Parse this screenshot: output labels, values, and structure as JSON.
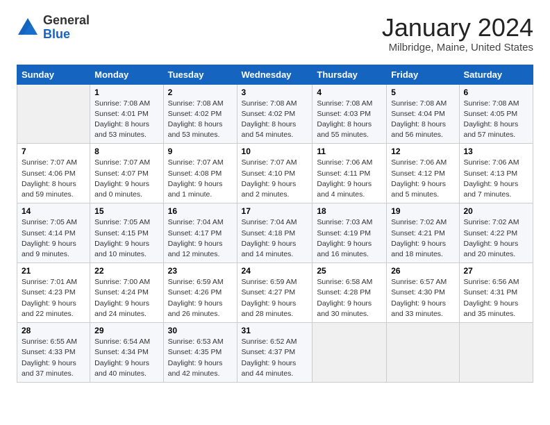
{
  "header": {
    "logo_general": "General",
    "logo_blue": "Blue",
    "title": "January 2024",
    "subtitle": "Milbridge, Maine, United States"
  },
  "days_of_week": [
    "Sunday",
    "Monday",
    "Tuesday",
    "Wednesday",
    "Thursday",
    "Friday",
    "Saturday"
  ],
  "weeks": [
    [
      {
        "num": "",
        "info": ""
      },
      {
        "num": "1",
        "info": "Sunrise: 7:08 AM\nSunset: 4:01 PM\nDaylight: 8 hours\nand 53 minutes."
      },
      {
        "num": "2",
        "info": "Sunrise: 7:08 AM\nSunset: 4:02 PM\nDaylight: 8 hours\nand 53 minutes."
      },
      {
        "num": "3",
        "info": "Sunrise: 7:08 AM\nSunset: 4:02 PM\nDaylight: 8 hours\nand 54 minutes."
      },
      {
        "num": "4",
        "info": "Sunrise: 7:08 AM\nSunset: 4:03 PM\nDaylight: 8 hours\nand 55 minutes."
      },
      {
        "num": "5",
        "info": "Sunrise: 7:08 AM\nSunset: 4:04 PM\nDaylight: 8 hours\nand 56 minutes."
      },
      {
        "num": "6",
        "info": "Sunrise: 7:08 AM\nSunset: 4:05 PM\nDaylight: 8 hours\nand 57 minutes."
      }
    ],
    [
      {
        "num": "7",
        "info": "Sunrise: 7:07 AM\nSunset: 4:06 PM\nDaylight: 8 hours\nand 59 minutes."
      },
      {
        "num": "8",
        "info": "Sunrise: 7:07 AM\nSunset: 4:07 PM\nDaylight: 9 hours\nand 0 minutes."
      },
      {
        "num": "9",
        "info": "Sunrise: 7:07 AM\nSunset: 4:08 PM\nDaylight: 9 hours\nand 1 minute."
      },
      {
        "num": "10",
        "info": "Sunrise: 7:07 AM\nSunset: 4:10 PM\nDaylight: 9 hours\nand 2 minutes."
      },
      {
        "num": "11",
        "info": "Sunrise: 7:06 AM\nSunset: 4:11 PM\nDaylight: 9 hours\nand 4 minutes."
      },
      {
        "num": "12",
        "info": "Sunrise: 7:06 AM\nSunset: 4:12 PM\nDaylight: 9 hours\nand 5 minutes."
      },
      {
        "num": "13",
        "info": "Sunrise: 7:06 AM\nSunset: 4:13 PM\nDaylight: 9 hours\nand 7 minutes."
      }
    ],
    [
      {
        "num": "14",
        "info": "Sunrise: 7:05 AM\nSunset: 4:14 PM\nDaylight: 9 hours\nand 9 minutes."
      },
      {
        "num": "15",
        "info": "Sunrise: 7:05 AM\nSunset: 4:15 PM\nDaylight: 9 hours\nand 10 minutes."
      },
      {
        "num": "16",
        "info": "Sunrise: 7:04 AM\nSunset: 4:17 PM\nDaylight: 9 hours\nand 12 minutes."
      },
      {
        "num": "17",
        "info": "Sunrise: 7:04 AM\nSunset: 4:18 PM\nDaylight: 9 hours\nand 14 minutes."
      },
      {
        "num": "18",
        "info": "Sunrise: 7:03 AM\nSunset: 4:19 PM\nDaylight: 9 hours\nand 16 minutes."
      },
      {
        "num": "19",
        "info": "Sunrise: 7:02 AM\nSunset: 4:21 PM\nDaylight: 9 hours\nand 18 minutes."
      },
      {
        "num": "20",
        "info": "Sunrise: 7:02 AM\nSunset: 4:22 PM\nDaylight: 9 hours\nand 20 minutes."
      }
    ],
    [
      {
        "num": "21",
        "info": "Sunrise: 7:01 AM\nSunset: 4:23 PM\nDaylight: 9 hours\nand 22 minutes."
      },
      {
        "num": "22",
        "info": "Sunrise: 7:00 AM\nSunset: 4:24 PM\nDaylight: 9 hours\nand 24 minutes."
      },
      {
        "num": "23",
        "info": "Sunrise: 6:59 AM\nSunset: 4:26 PM\nDaylight: 9 hours\nand 26 minutes."
      },
      {
        "num": "24",
        "info": "Sunrise: 6:59 AM\nSunset: 4:27 PM\nDaylight: 9 hours\nand 28 minutes."
      },
      {
        "num": "25",
        "info": "Sunrise: 6:58 AM\nSunset: 4:28 PM\nDaylight: 9 hours\nand 30 minutes."
      },
      {
        "num": "26",
        "info": "Sunrise: 6:57 AM\nSunset: 4:30 PM\nDaylight: 9 hours\nand 33 minutes."
      },
      {
        "num": "27",
        "info": "Sunrise: 6:56 AM\nSunset: 4:31 PM\nDaylight: 9 hours\nand 35 minutes."
      }
    ],
    [
      {
        "num": "28",
        "info": "Sunrise: 6:55 AM\nSunset: 4:33 PM\nDaylight: 9 hours\nand 37 minutes."
      },
      {
        "num": "29",
        "info": "Sunrise: 6:54 AM\nSunset: 4:34 PM\nDaylight: 9 hours\nand 40 minutes."
      },
      {
        "num": "30",
        "info": "Sunrise: 6:53 AM\nSunset: 4:35 PM\nDaylight: 9 hours\nand 42 minutes."
      },
      {
        "num": "31",
        "info": "Sunrise: 6:52 AM\nSunset: 4:37 PM\nDaylight: 9 hours\nand 44 minutes."
      },
      {
        "num": "",
        "info": ""
      },
      {
        "num": "",
        "info": ""
      },
      {
        "num": "",
        "info": ""
      }
    ]
  ]
}
